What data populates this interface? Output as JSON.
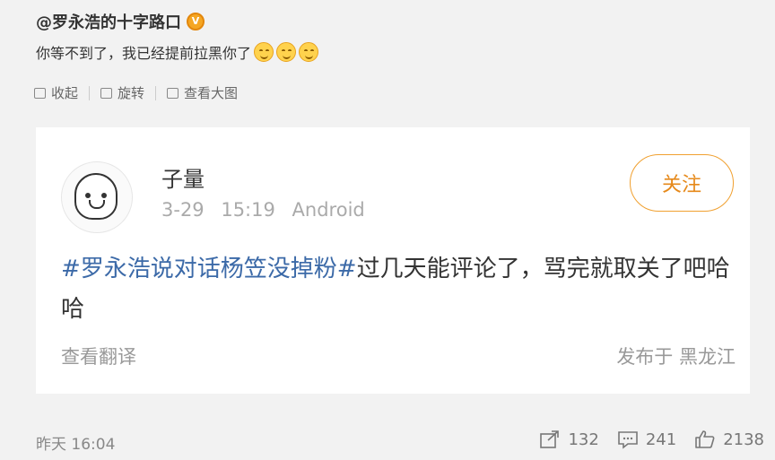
{
  "post": {
    "author_handle": "@罗永浩的十字路口",
    "text": "你等不到了，我已经提前拉黑你了"
  },
  "toolbar": {
    "collapse_label": "收起",
    "rotate_label": "旋转",
    "view_large_label": "查看大图"
  },
  "card": {
    "username": "子量",
    "date": "3-29 15:19",
    "device": "Android",
    "follow_label": "关注",
    "hashtag": "#罗永浩说对话杨笠没掉粉#",
    "text": "过几天能评论了，骂完就取关了吧哈哈",
    "translate_label": "查看翻译",
    "location": "发布于 黑龙江"
  },
  "footer": {
    "time": "昨天 16:04",
    "share_count": "132",
    "comment_count": "241",
    "like_count": "2138"
  },
  "colors": {
    "hashtag": "#3c6aa8",
    "follow_border": "#f0a030",
    "verified_badge": "#f5a623"
  },
  "icons": [
    "verified-icon",
    "smile-emoji-icon",
    "collapse-icon",
    "rotate-icon",
    "view-large-icon",
    "share-icon",
    "comment-icon",
    "like-icon"
  ]
}
